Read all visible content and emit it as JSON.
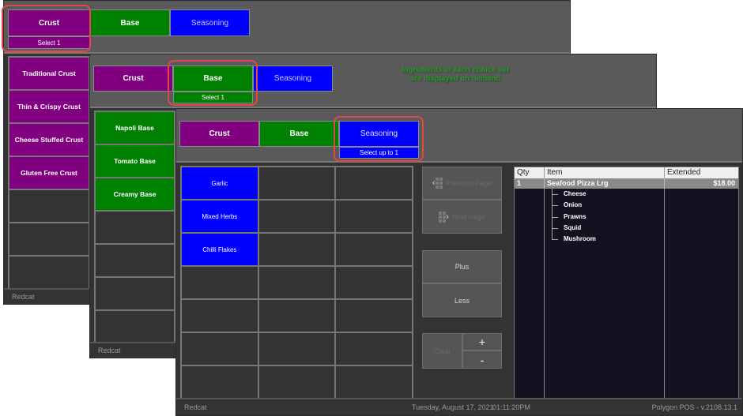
{
  "colors": {
    "crust": "#800080",
    "base": "#008000",
    "seasoning": "#0000ff",
    "highlight": "#e04848",
    "note": "#22a022"
  },
  "windows": [
    {
      "tabs": [
        {
          "label": "Crust",
          "sub": "Select 1",
          "active": true
        },
        {
          "label": "Base"
        },
        {
          "label": "Seasoning"
        }
      ],
      "items": [
        "Traditional Crust",
        "Thin & Crispy Crust",
        "Cheese Stuffed Crust",
        "Gluten Free Crust"
      ],
      "footer": "Redcat"
    },
    {
      "tabs": [
        {
          "label": "Crust"
        },
        {
          "label": "Base",
          "sub": "Select 1",
          "active": true
        },
        {
          "label": "Seasoning"
        }
      ],
      "items": [
        "Napoli Base",
        "Tomato Base",
        "Creamy Base"
      ],
      "footer": "Redcat",
      "annotation": "Ingredients in each choice set are displayed on demand"
    },
    {
      "tabs": [
        {
          "label": "Crust"
        },
        {
          "label": "Base"
        },
        {
          "label": "Seasoning",
          "sub": "Select up to 1",
          "active": true
        }
      ],
      "items": [
        "Garlic",
        "Mixed Herbs",
        "Chilli Flakes"
      ],
      "buttons": {
        "previous_page": "Previous Page",
        "next_page": "Next Page",
        "plus": "Plus",
        "less": "Less",
        "clear": "Clear",
        "increment": "+",
        "decrement": "-"
      },
      "order": {
        "columns": [
          "Qty",
          "Item",
          "Extended"
        ],
        "line": {
          "qty": "1",
          "item": "Seafood Pizza Lrg",
          "extended": "$18.00"
        },
        "modifiers": [
          "Cheese",
          "Onion",
          "Prawns",
          "Squid",
          "Mushroom"
        ]
      },
      "footer": {
        "brand": "Redcat",
        "date": "Tuesday, August 17, 2021",
        "time": "01:11:20PM",
        "version": "Polygon POS - v.2108.13.1"
      }
    }
  ]
}
